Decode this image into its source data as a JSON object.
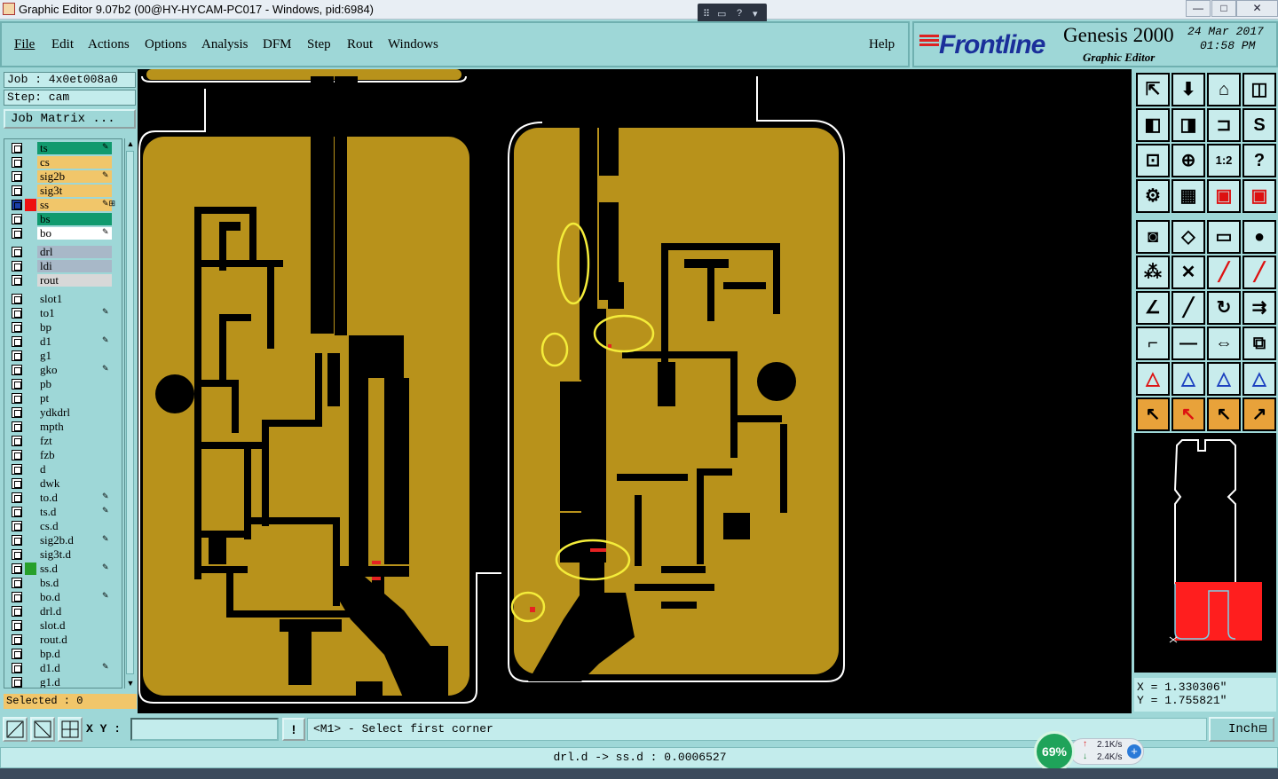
{
  "window": {
    "title": "Graphic Editor 9.07b2 (00@HY-HYCAM-PC017 - Windows, pid:6984)",
    "minimize": "—",
    "maximize": "□",
    "close": "✕"
  },
  "menu": {
    "items": [
      "File",
      "Edit",
      "Actions",
      "Options",
      "Analysis",
      "DFM",
      "Step",
      "Rout",
      "Windows"
    ],
    "help": "Help"
  },
  "brand": {
    "logo": "Frontline",
    "product": "Genesis 2000",
    "subtitle": "Graphic Editor",
    "date": "24 Mar 2017",
    "time": "01:58 PM"
  },
  "job": {
    "job_line": "Job : 4x0et008a0",
    "step_line": "Step: cam",
    "matrix_button": "Job Matrix ..."
  },
  "layers": [
    {
      "name": "ts",
      "color": "#119a6e",
      "marker": "✎"
    },
    {
      "name": "cs",
      "color": "#f1c66a",
      "marker": ""
    },
    {
      "name": "sig2b",
      "color": "#f1c66a",
      "marker": "✎"
    },
    {
      "name": "sig3t",
      "color": "#f1c66a",
      "marker": ""
    },
    {
      "name": "ss",
      "color": "#f1c66a",
      "marker": "✎⊞",
      "active": true
    },
    {
      "name": "bs",
      "color": "#119a6e",
      "marker": ""
    },
    {
      "name": "bo",
      "color": "#ffffff",
      "marker": "✎"
    },
    {
      "name": "drl",
      "color": "#a8b8c8",
      "marker": ""
    },
    {
      "name": "ldi",
      "color": "#a8b8c8",
      "marker": ""
    },
    {
      "name": "rout",
      "color": "#d8d8d8",
      "marker": ""
    },
    {
      "name": "slot1",
      "color": "#9ed7d7",
      "marker": ""
    },
    {
      "name": "to1",
      "color": "#9ed7d7",
      "marker": "✎"
    },
    {
      "name": "bp",
      "color": "#9ed7d7",
      "marker": ""
    },
    {
      "name": "d1",
      "color": "#9ed7d7",
      "marker": "✎"
    },
    {
      "name": "g1",
      "color": "#9ed7d7",
      "marker": ""
    },
    {
      "name": "gko",
      "color": "#9ed7d7",
      "marker": "✎"
    },
    {
      "name": "pb",
      "color": "#9ed7d7",
      "marker": ""
    },
    {
      "name": "pt",
      "color": "#9ed7d7",
      "marker": ""
    },
    {
      "name": "ydkdrl",
      "color": "#9ed7d7",
      "marker": ""
    },
    {
      "name": "mpth",
      "color": "#9ed7d7",
      "marker": ""
    },
    {
      "name": "fzt",
      "color": "#9ed7d7",
      "marker": ""
    },
    {
      "name": "fzb",
      "color": "#9ed7d7",
      "marker": ""
    },
    {
      "name": "d",
      "color": "#9ed7d7",
      "marker": ""
    },
    {
      "name": "dwk",
      "color": "#9ed7d7",
      "marker": ""
    },
    {
      "name": "to.d",
      "color": "#9ed7d7",
      "marker": "✎"
    },
    {
      "name": "ts.d",
      "color": "#9ed7d7",
      "marker": "✎"
    },
    {
      "name": "cs.d",
      "color": "#9ed7d7",
      "marker": ""
    },
    {
      "name": "sig2b.d",
      "color": "#9ed7d7",
      "marker": "✎"
    },
    {
      "name": "sig3t.d",
      "color": "#9ed7d7",
      "marker": ""
    },
    {
      "name": "ss.d",
      "color": "#9ed7d7",
      "marker": "✎",
      "highlight": true
    },
    {
      "name": "bs.d",
      "color": "#9ed7d7",
      "marker": ""
    },
    {
      "name": "bo.d",
      "color": "#9ed7d7",
      "marker": "✎"
    },
    {
      "name": "drl.d",
      "color": "#9ed7d7",
      "marker": ""
    },
    {
      "name": "slot.d",
      "color": "#9ed7d7",
      "marker": ""
    },
    {
      "name": "rout.d",
      "color": "#9ed7d7",
      "marker": ""
    },
    {
      "name": "bp.d",
      "color": "#9ed7d7",
      "marker": ""
    },
    {
      "name": "d1.d",
      "color": "#9ed7d7",
      "marker": "✎"
    },
    {
      "name": "g1.d",
      "color": "#9ed7d7",
      "marker": ""
    }
  ],
  "selected": "Selected : 0",
  "toolbar_icons": [
    "zoom-home-icon",
    "zoom-in-icon",
    "pan-icon",
    "split-view-icon",
    "move-left-icon",
    "move-right-icon",
    "fit-icon",
    "snake-icon",
    "zoom-fit-icon",
    "center-icon",
    "scale-1-2-icon",
    "help-icon",
    "settings-icon",
    "grid-icon",
    "layers-red-icon",
    "layers-red-2-icon",
    "pad-icon",
    "edit-shape-icon",
    "ruler-icon",
    "dot-icon",
    "connect-icon",
    "cross-icon",
    "line-red-icon",
    "line-red-2-icon",
    "angle-icon",
    "diagonal-icon",
    "rotate-icon",
    "flip-icon",
    "corner-icon",
    "minus-icon",
    "measure-icon",
    "swap-icon",
    "triangle-red-icon",
    "triangle-blue-icon",
    "triangle-arrow-icon",
    "triangle-line-icon",
    "select-icon",
    "select-red-icon",
    "select-circle-icon",
    "select-path-icon"
  ],
  "coords": {
    "x": "X = 1.330306\"",
    "y": "Y = 1.755821\""
  },
  "bottom": {
    "xy_label": "X Y :",
    "xy_value": "",
    "warn": "!",
    "prompt": "<M1> - Select first corner",
    "unit": "Inch"
  },
  "status": "drl.d -> ss.d : 0.0006527",
  "netmon": {
    "percent": "69%",
    "up": "2.1K/s",
    "down": "2.4K/s"
  },
  "colors": {
    "background": "#9ed7d7",
    "copper": "#b8921b",
    "canvas": "#000000",
    "highlight": "#f4ec3a"
  }
}
